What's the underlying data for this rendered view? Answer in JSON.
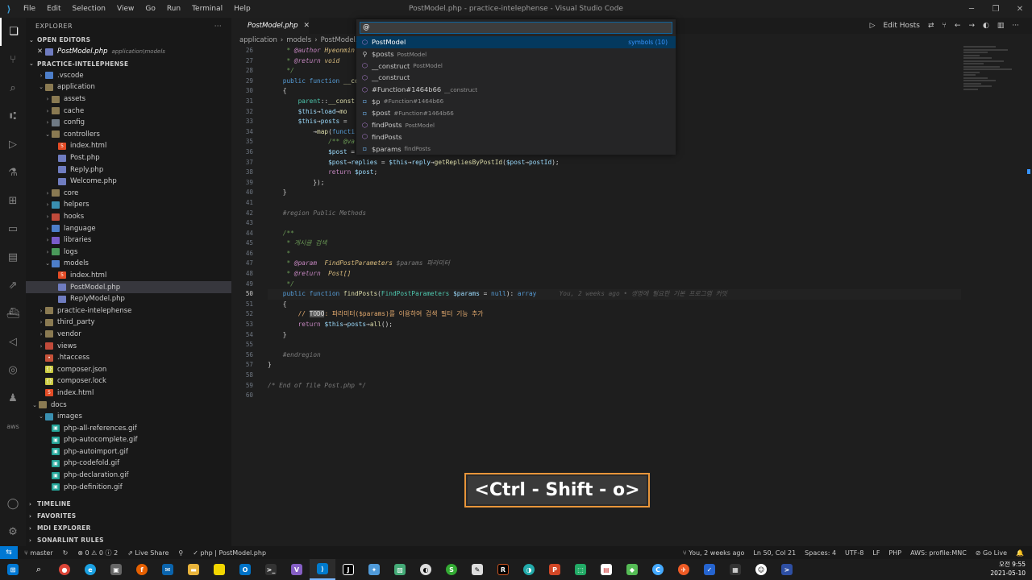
{
  "window": {
    "title": "PostModel.php - practice-intelephense - Visual Studio Code",
    "menu": [
      "File",
      "Edit",
      "Selection",
      "View",
      "Go",
      "Run",
      "Terminal",
      "Help"
    ]
  },
  "sidebar": {
    "header": "EXPLORER",
    "open_editors_label": "OPEN EDITORS",
    "open_editor": {
      "name": "PostModel.php",
      "path": "application\\models"
    },
    "project_label": "PRACTICE-INTELEPHENSE",
    "tree": [
      {
        "label": ".vscode",
        "kind": "folder",
        "color": "blue",
        "depth": 1,
        "open": false
      },
      {
        "label": "application",
        "kind": "folder",
        "color": "",
        "depth": 1,
        "open": true
      },
      {
        "label": "assets",
        "kind": "folder",
        "color": "",
        "depth": 2,
        "open": false
      },
      {
        "label": "cache",
        "kind": "folder",
        "color": "",
        "depth": 2,
        "open": false
      },
      {
        "label": "config",
        "kind": "folder",
        "color": "grey",
        "depth": 2,
        "open": false
      },
      {
        "label": "controllers",
        "kind": "folder",
        "color": "",
        "depth": 2,
        "open": true
      },
      {
        "label": "index.html",
        "kind": "html",
        "depth": 3
      },
      {
        "label": "Post.php",
        "kind": "php",
        "depth": 3
      },
      {
        "label": "Reply.php",
        "kind": "php",
        "depth": 3
      },
      {
        "label": "Welcome.php",
        "kind": "php",
        "depth": 3
      },
      {
        "label": "core",
        "kind": "folder",
        "color": "",
        "depth": 2,
        "open": false
      },
      {
        "label": "helpers",
        "kind": "folder",
        "color": "teal",
        "depth": 2,
        "open": false
      },
      {
        "label": "hooks",
        "kind": "folder",
        "color": "red",
        "depth": 2,
        "open": false
      },
      {
        "label": "language",
        "kind": "folder",
        "color": "blue",
        "depth": 2,
        "open": false
      },
      {
        "label": "libraries",
        "kind": "folder",
        "color": "purple",
        "depth": 2,
        "open": false
      },
      {
        "label": "logs",
        "kind": "folder",
        "color": "green",
        "depth": 2,
        "open": false
      },
      {
        "label": "models",
        "kind": "folder",
        "color": "blue",
        "depth": 2,
        "open": true
      },
      {
        "label": "index.html",
        "kind": "html",
        "depth": 3
      },
      {
        "label": "PostModel.php",
        "kind": "php",
        "depth": 3,
        "selected": true
      },
      {
        "label": "ReplyModel.php",
        "kind": "php",
        "depth": 3
      },
      {
        "label": "practice-intelephense",
        "kind": "folder",
        "color": "",
        "depth": 1,
        "open": false
      },
      {
        "label": "third_party",
        "kind": "folder",
        "color": "",
        "depth": 1,
        "open": false
      },
      {
        "label": "vendor",
        "kind": "folder",
        "color": "",
        "depth": 1,
        "open": false
      },
      {
        "label": "views",
        "kind": "folder",
        "color": "red",
        "depth": 1,
        "open": false
      },
      {
        "label": ".htaccess",
        "kind": "dot",
        "depth": 1
      },
      {
        "label": "composer.json",
        "kind": "json",
        "depth": 1
      },
      {
        "label": "composer.lock",
        "kind": "json",
        "depth": 1
      },
      {
        "label": "index.html",
        "kind": "html",
        "depth": 1
      },
      {
        "label": "docs",
        "kind": "folder",
        "color": "",
        "depth": 0,
        "open": true
      },
      {
        "label": "images",
        "kind": "folder",
        "color": "teal",
        "depth": 1,
        "open": true
      },
      {
        "label": "php-all-references.gif",
        "kind": "gif",
        "depth": 2
      },
      {
        "label": "php-autocomplete.gif",
        "kind": "gif",
        "depth": 2
      },
      {
        "label": "php-autoimport.gif",
        "kind": "gif",
        "depth": 2
      },
      {
        "label": "php-codefold.gif",
        "kind": "gif",
        "depth": 2
      },
      {
        "label": "php-declaration.gif",
        "kind": "gif",
        "depth": 2
      },
      {
        "label": "php-definition.gif",
        "kind": "gif",
        "depth": 2
      }
    ],
    "bottom_sections": [
      "TIMELINE",
      "FAVORITES",
      "MDI EXPLORER",
      "SONARLINT RULES"
    ]
  },
  "editor": {
    "tab_label": "PostModel.php",
    "actions": [
      "Edit Hosts"
    ],
    "breadcrumb": [
      "application",
      "models",
      "PostModel..."
    ]
  },
  "quickpick": {
    "input_value": "@",
    "items": [
      {
        "icon": "class-icon",
        "label": "PostModel",
        "desc": "",
        "right": "symbols (10)",
        "selected": true
      },
      {
        "icon": "property-icon",
        "label": "$posts",
        "desc": "PostModel"
      },
      {
        "icon": "method-icon",
        "label": "__construct",
        "desc": "PostModel"
      },
      {
        "icon": "method-icon",
        "label": "__construct",
        "desc": ""
      },
      {
        "icon": "method-icon",
        "label": "#Function#1464b66",
        "desc": "__construct"
      },
      {
        "icon": "variable-icon",
        "label": "$p",
        "desc": "#Function#1464b66"
      },
      {
        "icon": "variable-icon",
        "label": "$post",
        "desc": "#Function#1464b66"
      },
      {
        "icon": "method-icon",
        "label": "findPosts",
        "desc": "PostModel"
      },
      {
        "icon": "method-icon",
        "label": "findPosts",
        "desc": ""
      },
      {
        "icon": "variable-icon",
        "label": "$params",
        "desc": "findPosts"
      }
    ]
  },
  "line_numbers": [
    "26",
    "27",
    "28",
    "29",
    "30",
    "31",
    "32",
    "33",
    "34",
    "35",
    "36",
    "37",
    "38",
    "39",
    "40",
    "41",
    "42",
    "43",
    "44",
    "45",
    "46",
    "47",
    "48",
    "49",
    "50",
    "51",
    "52",
    "53",
    "54",
    "55",
    "56",
    "57",
    "58",
    "59",
    "60"
  ],
  "current_line": "50",
  "code_text": {
    "author_tag": "@author",
    "author": "Hyeonmin",
    "return_tag": "@return",
    "void": "void",
    "region": "#region Public Methods",
    "kor_title": "게시글 검색",
    "param_tag": "@param",
    "param_type": "FindPostParameters",
    "param_name": "$params",
    "param_desc": "파라미터",
    "ret_type": "Post[]",
    "todo": "TODO",
    "todo_text": ": 파라미터($params)를 이용하여 검색 필터 기능 추가",
    "blame": "You, 2 weeks ago • 생명에 필요한 기본 프로그램 커밋",
    "endregion": "#endregion",
    "eof": "/* End of file Post.php */"
  },
  "keybinding_overlay": "<Ctrl - Shift - o>",
  "statusbar": {
    "branch": "master",
    "errors": "0",
    "warnings": "0",
    "info": "2",
    "liveshare": "Live Share",
    "lang_crumb": "php",
    "file_crumb": "PostModel.php",
    "blame": "You, 2 weeks ago",
    "position": "Ln 50, Col 21",
    "spaces": "Spaces: 4",
    "encoding": "UTF-8",
    "eol": "LF",
    "language": "PHP",
    "aws": "AWS: profile:MNC",
    "golive": "Go Live"
  },
  "taskbar": {
    "time": "오전 9:55",
    "date": "2021-05-10"
  },
  "colors": {
    "accent": "#0078d4",
    "overlay_border": "#e8953a",
    "selection": "#04395e"
  }
}
